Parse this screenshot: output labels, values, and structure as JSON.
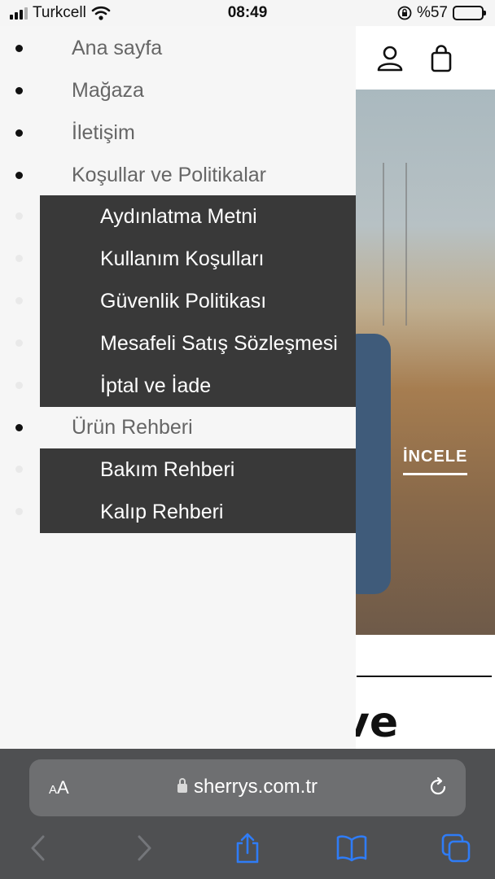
{
  "status_bar": {
    "carrier": "Turkcell",
    "time": "08:49",
    "battery": "%57",
    "battery_level": 0.57
  },
  "page": {
    "hero_cta": "İNCELE",
    "partial_heading": "ve"
  },
  "side_menu": {
    "items": [
      {
        "label": "Ana sayfa"
      },
      {
        "label": "Mağaza"
      },
      {
        "label": "İletişim"
      },
      {
        "label": "Koşullar ve Politikalar"
      },
      {
        "label": "Ürün Rehberi"
      }
    ],
    "policies_submenu": [
      {
        "label": "Aydınlatma Metni"
      },
      {
        "label": "Kullanım Koşulları"
      },
      {
        "label": "Güvenlik Politikası"
      },
      {
        "label": "Mesafeli Satış Sözleşmesi"
      },
      {
        "label": "İptal ve İade"
      }
    ],
    "guide_submenu": [
      {
        "label": "Bakım Rehberi"
      },
      {
        "label": "Kalıp Rehberi"
      }
    ]
  },
  "browser": {
    "aa_small": "A",
    "aa_large": "A",
    "url": "sherrys.com.tr"
  },
  "icons": {
    "account": "user-icon",
    "cart": "shopping-bag-icon",
    "lock": "lock-icon",
    "reload": "reload-icon",
    "back": "back-arrow-icon",
    "forward": "forward-arrow-icon",
    "share": "share-icon",
    "bookmarks": "book-icon",
    "tabs": "tabs-icon"
  },
  "colors": {
    "menu_bg": "#f6f6f6",
    "submenu_bg": "#393939",
    "safari_accent": "#2f7cf6",
    "browser_bar": "#4f5052"
  }
}
